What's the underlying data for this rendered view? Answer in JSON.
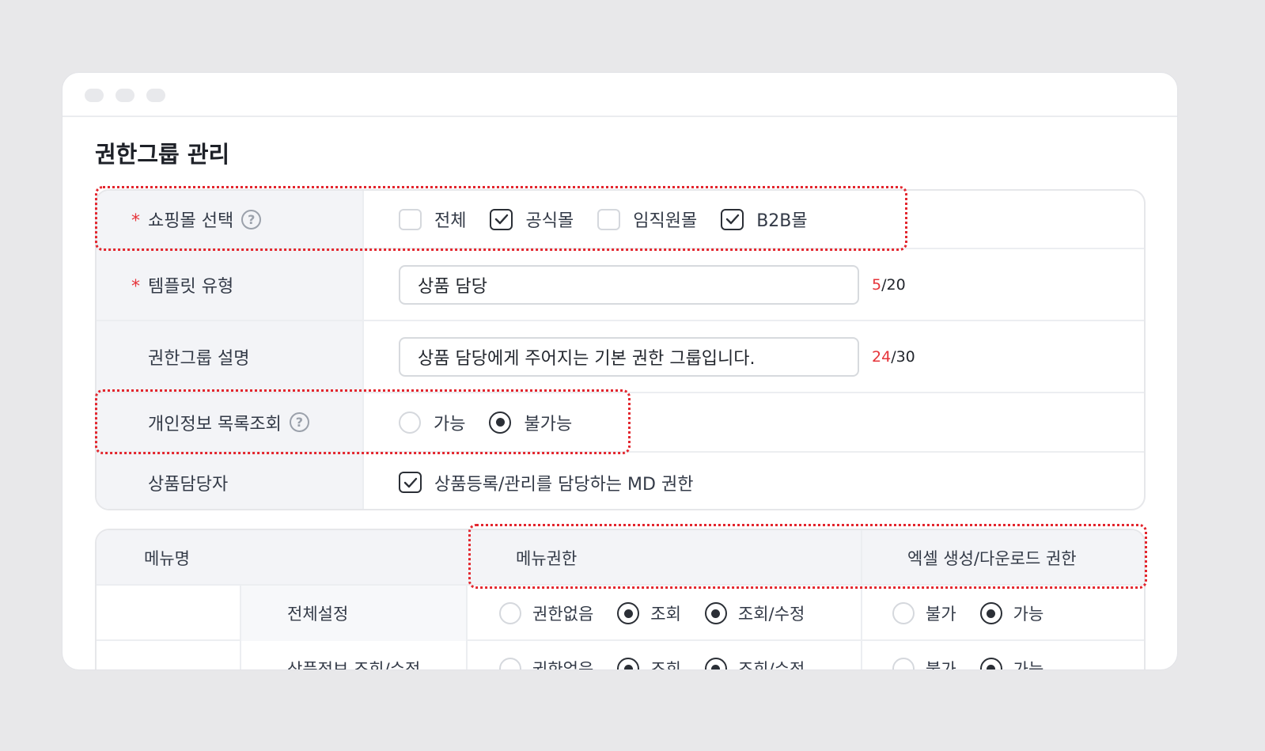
{
  "page": {
    "title": "권한그룹 관리"
  },
  "form": {
    "mall": {
      "label": "쇼핑몰 선택",
      "required": "*",
      "help": "?",
      "options": [
        {
          "label": "전체",
          "checked": false
        },
        {
          "label": "공식몰",
          "checked": true
        },
        {
          "label": "임직원몰",
          "checked": false
        },
        {
          "label": "B2B몰",
          "checked": true
        }
      ]
    },
    "template": {
      "label": "템플릿 유형",
      "required": "*",
      "value": "상품 담당",
      "count": "5",
      "max": "/20"
    },
    "description": {
      "label": "권한그룹 설명",
      "value": "상품 담당에게 주어지는 기본 권한 그룹입니다.",
      "count": "24",
      "max": "/30"
    },
    "privacy": {
      "label": "개인정보 목록조회",
      "help": "?",
      "options": [
        {
          "label": "가능",
          "selected": false
        },
        {
          "label": "불가능",
          "selected": true
        }
      ]
    },
    "manager": {
      "label": "상품담당자",
      "checkbox_label": "상품등록/관리를 담당하는 MD 권한",
      "checked": true
    }
  },
  "table": {
    "headers": {
      "menu": "메뉴명",
      "menu_perm": "메뉴권한",
      "excel_perm": "엑셀 생성/다운로드 권한"
    },
    "rows": [
      {
        "name": "전체설정",
        "menu_options": [
          "권한없음",
          "조회",
          "조회/수정"
        ],
        "menu_selected": [
          false,
          true,
          true
        ],
        "excel_options": [
          "불가",
          "가능"
        ],
        "excel_selected": [
          false,
          true
        ]
      },
      {
        "name": "상품정보 조회/수정",
        "menu_options": [
          "권한없음",
          "조회",
          "조회/수정"
        ],
        "menu_selected": [
          false,
          true,
          true
        ],
        "excel_options": [
          "불가",
          "가능"
        ],
        "excel_selected": [
          false,
          true
        ]
      }
    ]
  },
  "colors": {
    "accent": "#e6343a",
    "highlight": "#e3262e",
    "label_bg": "#f3f4f7"
  }
}
